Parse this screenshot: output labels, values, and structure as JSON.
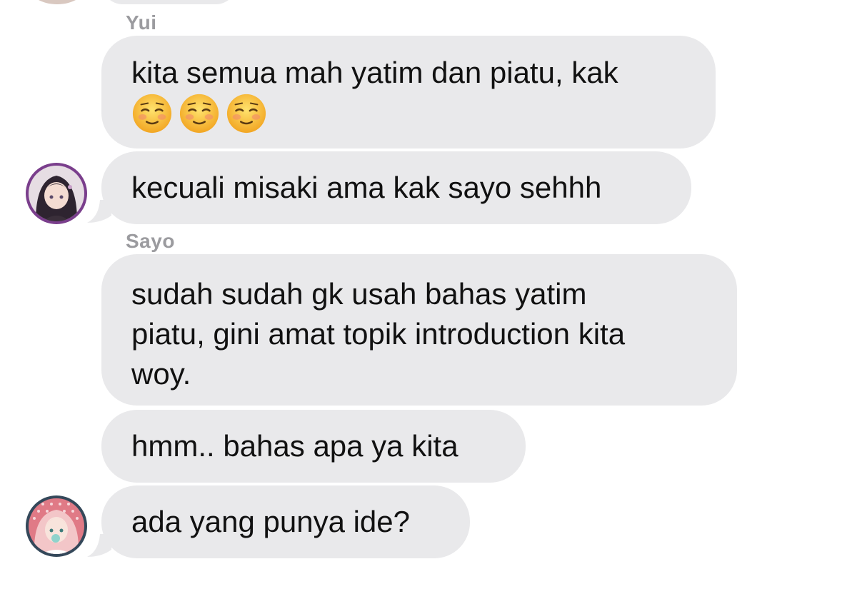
{
  "conversation": {
    "messages": [
      {
        "sender": "Yui",
        "text": "kita semua mah yatim dan piatu, kak",
        "emojis": [
          "relieved-smiling-face",
          "relieved-smiling-face",
          "relieved-smiling-face"
        ]
      },
      {
        "text": "kecuali misaki ama kak sayo sehhh",
        "avatar": "yui-avatar"
      },
      {
        "sender": "Sayo",
        "text_lines": [
          "sudah sudah gk usah bahas yatim",
          "piatu, gini amat topik introduction kita",
          "woy."
        ]
      },
      {
        "text": "hmm.. bahas apa ya kita"
      },
      {
        "text": "ada yang punya ide?",
        "avatar": "sayo-avatar"
      }
    ]
  },
  "colors": {
    "bubble": "#e9e9eb",
    "sender_name": "#9b9b9f",
    "text": "#111111"
  }
}
